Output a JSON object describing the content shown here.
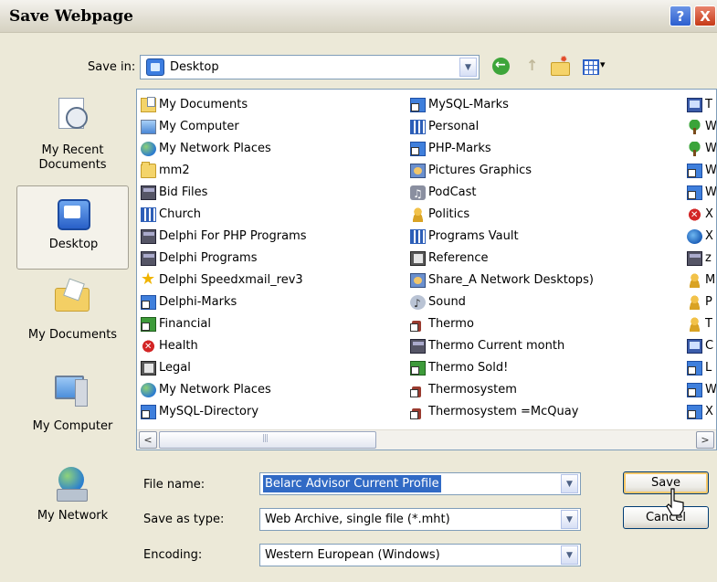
{
  "window": {
    "title": "Save Webpage",
    "help_label": "?",
    "close_label": "X"
  },
  "toolbar": {
    "save_in_label": "Save in:",
    "save_in_value": "Desktop"
  },
  "places": [
    {
      "label": "My Recent Documents",
      "icon": "recent-documents-icon"
    },
    {
      "label": "Desktop",
      "icon": "desktop-icon",
      "selected": true
    },
    {
      "label": "My Documents",
      "icon": "my-documents-icon"
    },
    {
      "label": "My Computer",
      "icon": "my-computer-icon"
    },
    {
      "label": "My Network",
      "icon": "my-network-icon"
    }
  ],
  "files": {
    "col1": [
      {
        "name": "My Documents",
        "icon": "docs"
      },
      {
        "name": "My Computer",
        "icon": "computer"
      },
      {
        "name": "My Network Places",
        "icon": "network"
      },
      {
        "name": "mm2",
        "icon": "folder"
      },
      {
        "name": "Bid Files",
        "icon": "app"
      },
      {
        "name": "Church",
        "icon": "chart"
      },
      {
        "name": "Delphi For PHP Programs",
        "icon": "app"
      },
      {
        "name": "Delphi Programs",
        "icon": "app"
      },
      {
        "name": "Delphi Speedxmail_rev3",
        "icon": "star"
      },
      {
        "name": "Delphi-Marks",
        "icon": "shortcut"
      },
      {
        "name": "Financial",
        "icon": "green"
      },
      {
        "name": "Health",
        "icon": "red"
      },
      {
        "name": "Legal",
        "icon": "book"
      },
      {
        "name": "My Network Places",
        "icon": "network"
      },
      {
        "name": "MySQL-Directory",
        "icon": "shortcut"
      }
    ],
    "col2": [
      {
        "name": "MySQL-Marks",
        "icon": "shortcut"
      },
      {
        "name": "Personal",
        "icon": "chart"
      },
      {
        "name": "PHP-Marks",
        "icon": "shortcut"
      },
      {
        "name": "Pictures Graphics",
        "icon": "pics"
      },
      {
        "name": "PodCast",
        "icon": "music"
      },
      {
        "name": "Politics",
        "icon": "person"
      },
      {
        "name": "Programs Vault",
        "icon": "chart"
      },
      {
        "name": "Reference",
        "icon": "book"
      },
      {
        "name": "Share_A Network Desktops)",
        "icon": "pics"
      },
      {
        "name": "Sound",
        "icon": "sound"
      },
      {
        "name": "Thermo",
        "icon": "thermo"
      },
      {
        "name": "Thermo Current month",
        "icon": "app"
      },
      {
        "name": "Thermo Sold!",
        "icon": "green"
      },
      {
        "name": "Thermosystem",
        "icon": "thermo"
      },
      {
        "name": "Thermosystem =McQuay",
        "icon": "thermo"
      }
    ],
    "col3": [
      {
        "name": "T",
        "icon": "mon"
      },
      {
        "name": "W",
        "icon": "tree"
      },
      {
        "name": "W",
        "icon": "tree"
      },
      {
        "name": "W",
        "icon": "shortcut"
      },
      {
        "name": "W",
        "icon": "shortcut"
      },
      {
        "name": "X",
        "icon": "red"
      },
      {
        "name": "X",
        "icon": "globe"
      },
      {
        "name": "z",
        "icon": "app"
      },
      {
        "name": "M",
        "icon": "person"
      },
      {
        "name": "P",
        "icon": "person"
      },
      {
        "name": "T",
        "icon": "person"
      },
      {
        "name": "C",
        "icon": "mon"
      },
      {
        "name": "L",
        "icon": "shortcut"
      },
      {
        "name": "W",
        "icon": "shortcut"
      },
      {
        "name": "X",
        "icon": "shortcut"
      }
    ]
  },
  "scrollbar": {
    "left_arrow": "<",
    "right_arrow": ">"
  },
  "form": {
    "file_name_label": "File name:",
    "file_name_value": "Belarc Advisor Current Profile",
    "save_as_type_label": "Save as type:",
    "save_as_type_value": "Web Archive, single file (*.mht)",
    "encoding_label": "Encoding:",
    "encoding_value": "Western European (Windows)"
  },
  "buttons": {
    "save_label": "Save",
    "cancel_label": "Cancel"
  }
}
